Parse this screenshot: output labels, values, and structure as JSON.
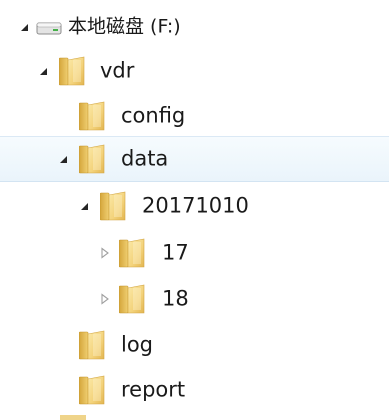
{
  "tree": {
    "drive": {
      "label": "本地磁盘 (F:)",
      "icon": "drive-icon",
      "expanded": true
    },
    "vdr": {
      "label": "vdr",
      "icon": "folder-icon",
      "expanded": true
    },
    "config": {
      "label": "config",
      "icon": "folder-icon"
    },
    "data": {
      "label": "data",
      "icon": "folder-icon",
      "expanded": true,
      "selected": true
    },
    "date_folder": {
      "label": "20171010",
      "icon": "folder-icon",
      "expanded": true
    },
    "f17": {
      "label": "17",
      "icon": "folder-icon",
      "expanded": false
    },
    "f18": {
      "label": "18",
      "icon": "folder-icon",
      "expanded": false
    },
    "log": {
      "label": "log",
      "icon": "folder-icon"
    },
    "report": {
      "label": "report",
      "icon": "folder-icon"
    }
  },
  "colors": {
    "selection_bg": "#eaf4fb",
    "folder_yellow": "#e9c25a",
    "text": "#1a1a1a"
  }
}
